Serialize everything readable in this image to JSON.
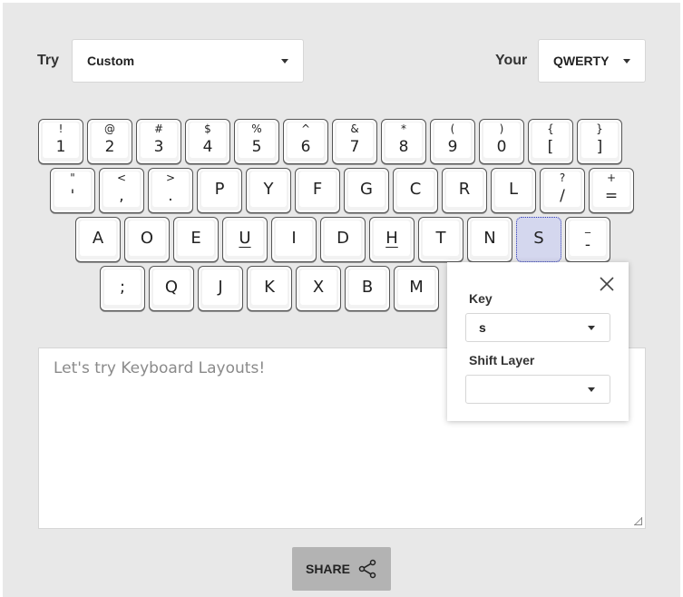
{
  "header": {
    "try_label": "Try",
    "try_select": "Custom",
    "your_label": "Your",
    "your_select": "QWERTY"
  },
  "keyboard": {
    "rows": [
      [
        {
          "shift": "!",
          "main": "1"
        },
        {
          "shift": "@",
          "main": "2"
        },
        {
          "shift": "#",
          "main": "3"
        },
        {
          "shift": "$",
          "main": "4"
        },
        {
          "shift": "%",
          "main": "5"
        },
        {
          "shift": "^",
          "main": "6"
        },
        {
          "shift": "&",
          "main": "7"
        },
        {
          "shift": "*",
          "main": "8"
        },
        {
          "shift": "(",
          "main": "9"
        },
        {
          "shift": ")",
          "main": "0"
        },
        {
          "shift": "{",
          "main": "["
        },
        {
          "shift": "}",
          "main": "]"
        }
      ],
      [
        {
          "shift": "\"",
          "main": "'"
        },
        {
          "shift": "<",
          "main": ","
        },
        {
          "shift": ">",
          "main": "."
        },
        {
          "shift": "",
          "main": "P"
        },
        {
          "shift": "",
          "main": "Y"
        },
        {
          "shift": "",
          "main": "F"
        },
        {
          "shift": "",
          "main": "G"
        },
        {
          "shift": "",
          "main": "C"
        },
        {
          "shift": "",
          "main": "R"
        },
        {
          "shift": "",
          "main": "L"
        },
        {
          "shift": "?",
          "main": "/"
        },
        {
          "shift": "+",
          "main": "="
        }
      ],
      [
        {
          "shift": "",
          "main": "A"
        },
        {
          "shift": "",
          "main": "O"
        },
        {
          "shift": "",
          "main": "E"
        },
        {
          "shift": "",
          "main": "U",
          "underline": true
        },
        {
          "shift": "",
          "main": "I"
        },
        {
          "shift": "",
          "main": "D"
        },
        {
          "shift": "",
          "main": "H",
          "underline": true
        },
        {
          "shift": "",
          "main": "T"
        },
        {
          "shift": "",
          "main": "N"
        },
        {
          "shift": "",
          "main": "S",
          "selected": true
        },
        {
          "shift": "_",
          "main": "-"
        }
      ],
      [
        {
          "shift": "",
          "main": ";"
        },
        {
          "shift": "",
          "main": "Q"
        },
        {
          "shift": "",
          "main": "J"
        },
        {
          "shift": "",
          "main": "K"
        },
        {
          "shift": "",
          "main": "X"
        },
        {
          "shift": "",
          "main": "B"
        },
        {
          "shift": "",
          "main": "M"
        }
      ]
    ]
  },
  "editor": {
    "placeholder": "Let's try Keyboard Layouts!"
  },
  "share": {
    "label": "SHARE"
  },
  "popup": {
    "key_label": "Key",
    "key_value": "s",
    "shift_label": "Shift Layer",
    "shift_value": ""
  }
}
